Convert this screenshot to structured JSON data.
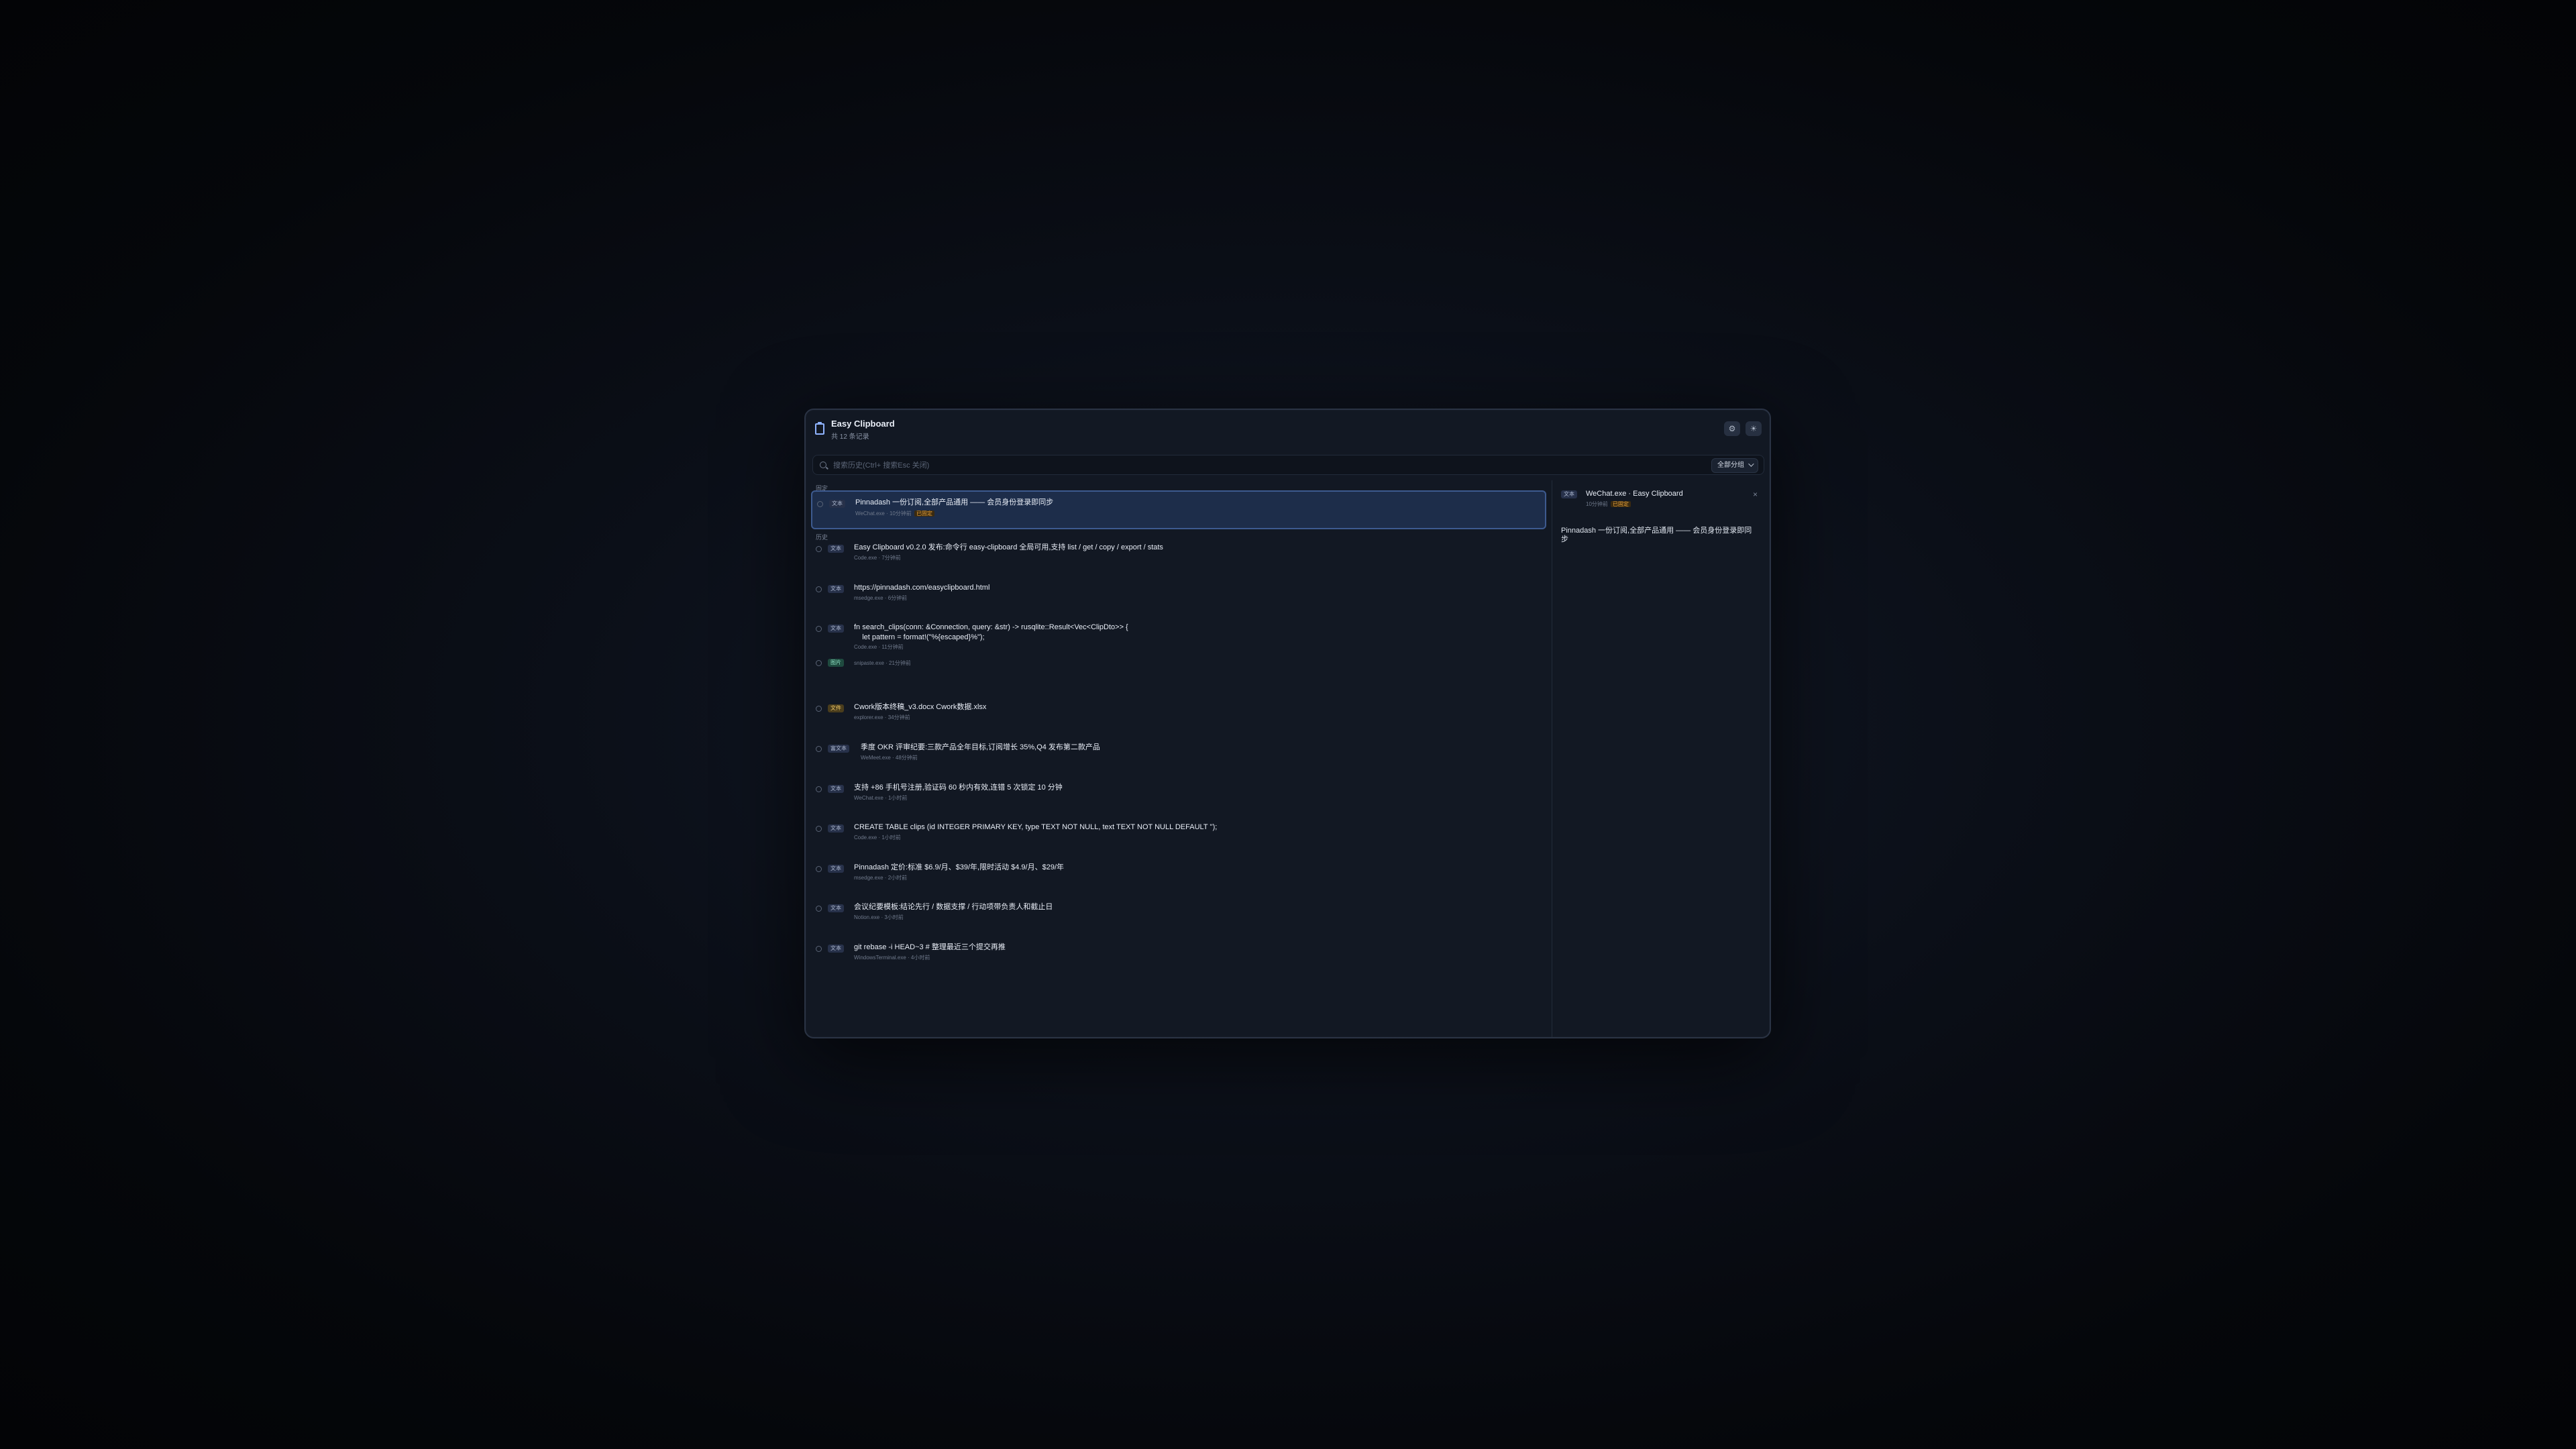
{
  "app": {
    "title": "Easy Clipboard",
    "subtitle": "共 12 条记录"
  },
  "toolbar": {
    "settings_icon": "gear-icon",
    "theme_icon": "sun-icon"
  },
  "search": {
    "placeholder": "搜索历史(Ctrl+ 搜索Esc 关闭)",
    "filter_label": "全部分组"
  },
  "sections": {
    "pinned": "固定",
    "history": "历史"
  },
  "items": [
    {
      "type": "文本",
      "text": "Pinnadash 一份订阅,全部产品通用 —— 会员身份登录即同步",
      "meta": "WeChat.exe · 10分钟前",
      "pinned_label": "已固定"
    },
    {
      "type": "文本",
      "text": "Easy Clipboard v0.2.0 发布:命令行 easy-clipboard 全局可用,支持 list / get / copy / export / stats",
      "meta": "Code.exe · 7分钟前"
    },
    {
      "type": "文本",
      "text": "https://pinnadash.com/easyclipboard.html",
      "meta": "msedge.exe · 6分钟前"
    },
    {
      "type": "文本",
      "text": "fn search_clips(conn: &Connection, query: &str) -> rusqlite::Result<Vec<ClipDto>> {\n    let pattern = format!(\"%{escaped}%\");",
      "meta": "Code.exe · 11分钟前"
    },
    {
      "type": "图片",
      "text": "",
      "meta": "snipaste.exe · 21分钟前"
    },
    {
      "type": "文件",
      "text": "Cwork版本终稿_v3.docx Cwork数据.xlsx",
      "meta": "explorer.exe · 34分钟前"
    },
    {
      "type": "富文本",
      "text": "季度 OKR 评审纪要:三款产品全年目标,订阅增长 35%,Q4 发布第二款产品",
      "meta": "WeMeet.exe · 48分钟前"
    },
    {
      "type": "文本",
      "text": "支持 +86 手机号注册,验证码 60 秒内有效,连错 5 次锁定 10 分钟",
      "meta": "WeChat.exe · 1小时前"
    },
    {
      "type": "文本",
      "text": "CREATE TABLE clips (id INTEGER PRIMARY KEY, type TEXT NOT NULL, text TEXT NOT NULL DEFAULT '');",
      "meta": "Code.exe · 1小时前"
    },
    {
      "type": "文本",
      "text": "Pinnadash 定价:标准 $6.9/月、$39/年,限时活动 $4.9/月、$29/年",
      "meta": "msedge.exe · 2小时前"
    },
    {
      "type": "文本",
      "text": "会议纪要模板:结论先行 / 数据支撑 / 行动项带负责人和截止日",
      "meta": "Notion.exe · 3小时前"
    },
    {
      "type": "文本",
      "text": "git rebase -i HEAD~3 # 整理最近三个提交再推",
      "meta": "WindowsTerminal.exe · 4小时前"
    }
  ],
  "detail": {
    "type": "文本",
    "title": "WeChat.exe · Easy Clipboard",
    "meta": "10分钟前",
    "pinned_label": "已固定",
    "close": "×",
    "body": "Pinnadash 一份订阅,全部产品通用 —— 会员身份登录即同步"
  }
}
